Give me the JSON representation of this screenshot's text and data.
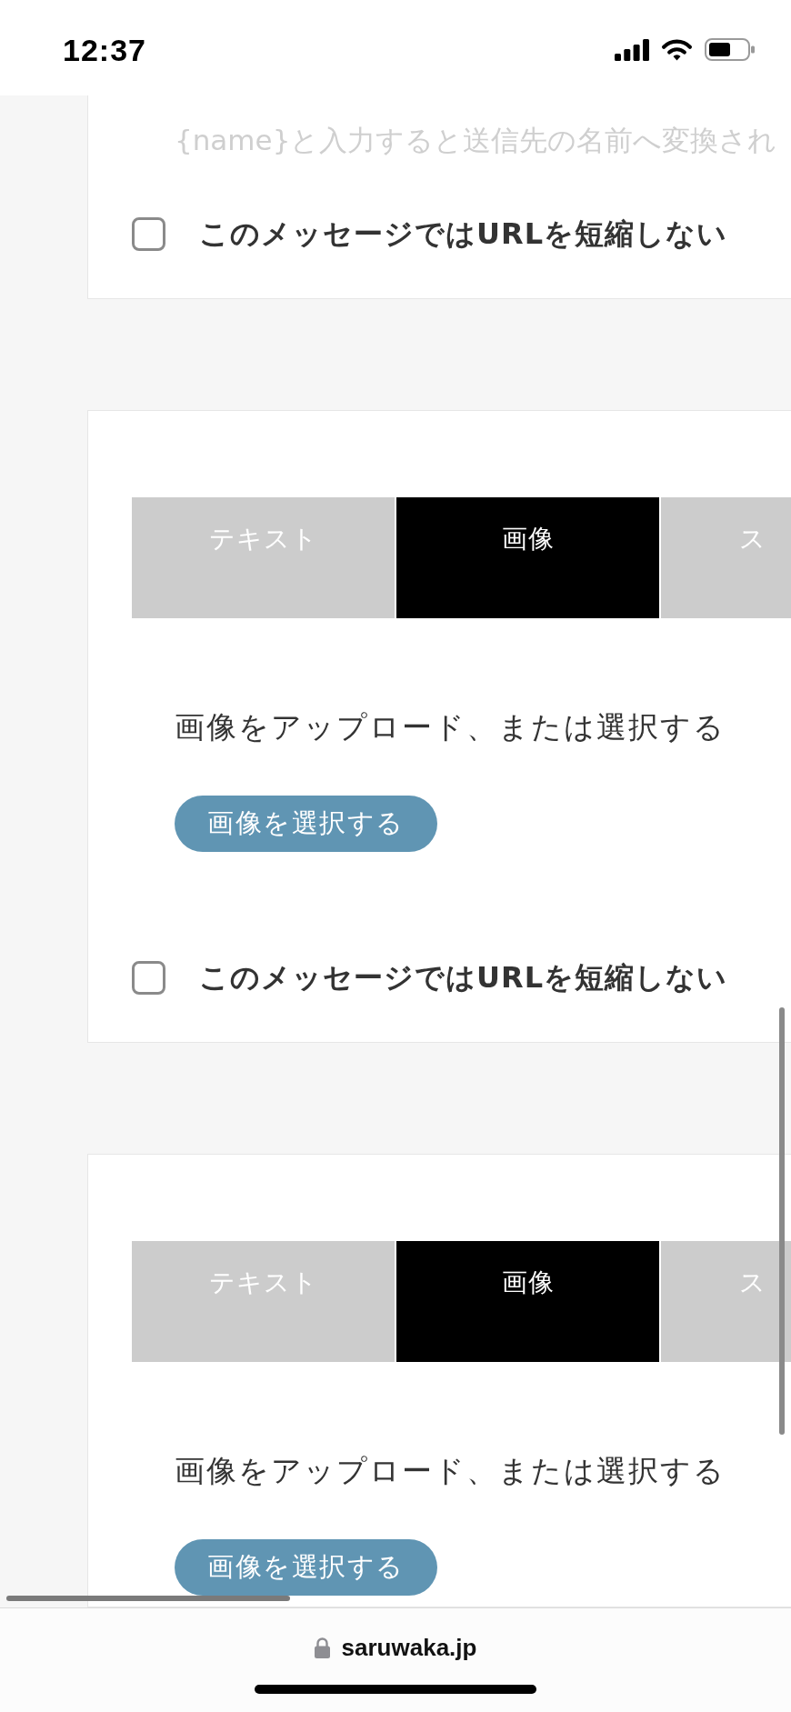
{
  "status_bar": {
    "time": "12:37"
  },
  "cards": [
    {
      "message_field": {
        "placeholder": "{name}と入力すると送信先の名前へ変換され"
      },
      "url_option": {
        "label": "このメッセージではURLを短縮しない",
        "checked": false
      }
    },
    {
      "tabs": [
        {
          "label": "テキスト",
          "selected": false
        },
        {
          "label": "画像",
          "selected": true
        },
        {
          "label": "ス",
          "selected": false
        }
      ],
      "upload_prompt": "画像をアップロード、または選択する",
      "select_button": "画像を選択する",
      "url_option": {
        "label": "このメッセージではURLを短縮しない",
        "checked": false
      }
    },
    {
      "tabs": [
        {
          "label": "テキスト",
          "selected": false
        },
        {
          "label": "画像",
          "selected": true
        },
        {
          "label": "ス",
          "selected": false
        }
      ],
      "upload_prompt": "画像をアップロード、または選択する",
      "select_button": "画像を選択する"
    }
  ],
  "browser_bar": {
    "url": "saruwaka.jp"
  }
}
